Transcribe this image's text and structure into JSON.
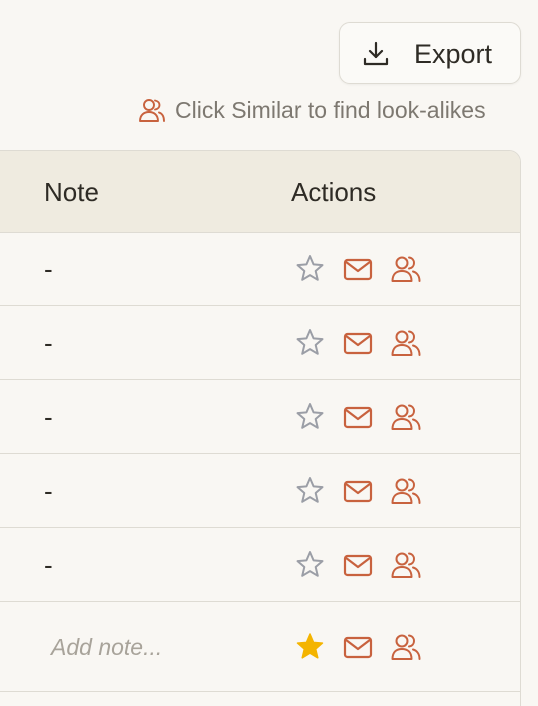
{
  "toolbar": {
    "export_label": "Export"
  },
  "hint": {
    "text": "Click Similar to find look-alikes"
  },
  "table": {
    "columns": [
      "Note",
      "Actions"
    ],
    "rows": [
      {
        "note": "-",
        "starred": false
      },
      {
        "note": "-",
        "starred": false
      },
      {
        "note": "-",
        "starred": false
      },
      {
        "note": "-",
        "starred": false
      },
      {
        "note": "-",
        "starred": false
      },
      {
        "note": "",
        "note_placeholder": "Add note...",
        "starred": true
      }
    ]
  },
  "icons": {
    "export": "download-icon",
    "hint": "users-icon",
    "star": "star-icon",
    "mail": "mail-icon",
    "similar": "users-icon"
  },
  "colors": {
    "accent": "#c8623e",
    "star_outline": "#9b9ea6",
    "star_filled": "#f4b400",
    "header_bg": "#efebe0",
    "page_bg": "#f9f7f3"
  }
}
